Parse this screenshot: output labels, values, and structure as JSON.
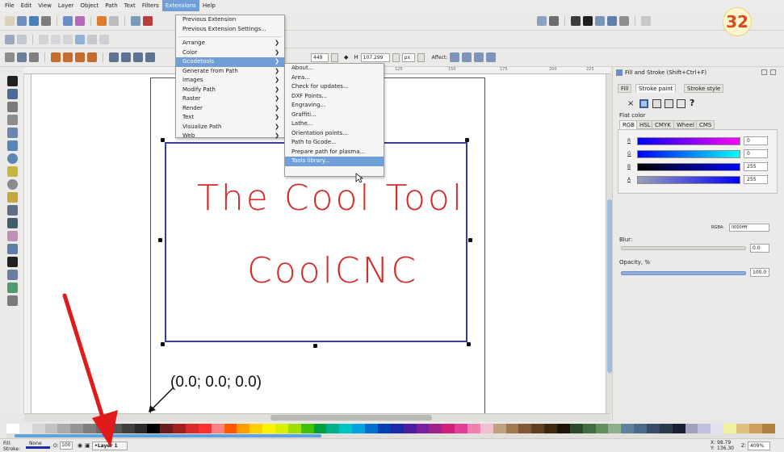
{
  "menubar": [
    "File",
    "Edit",
    "View",
    "Layer",
    "Object",
    "Path",
    "Text",
    "Filters",
    "Extensions",
    "Help"
  ],
  "active_menu": "Extensions",
  "extensions_menu": {
    "top": [
      "Previous Extension",
      "Previous Extension Settings..."
    ],
    "items": [
      "Arrange",
      "Color",
      "Gcodetools",
      "Generate from Path",
      "Images",
      "Modify Path",
      "Raster",
      "Render",
      "Text",
      "Visualize Path",
      "Web"
    ],
    "highlighted": "Gcodetools"
  },
  "gcodetools_menu": {
    "items": [
      "About...",
      "Area...",
      "Check for updates...",
      "DXF Points...",
      "Engraving...",
      "Graffiti...",
      "Lathe...",
      "Orientation points...",
      "Path to Gcode...",
      "Prepare path for plasma...",
      "Tools library..."
    ],
    "highlighted": "Tools library..."
  },
  "toolbar_fields": {
    "h_label": "H",
    "h_value": "107.299",
    "w_value": "449",
    "unit": "px",
    "affect_label": "Affect:"
  },
  "ruler_labels": [
    "125",
    "150",
    "175",
    "200",
    "225"
  ],
  "canvas": {
    "line1": "The Cool Tool",
    "line2": "CoolCNC",
    "origin_label": "(0.0; 0.0; 0.0)"
  },
  "badge": "32",
  "fill_stroke": {
    "title": "Fill and Stroke (Shift+Ctrl+F)",
    "tabs": [
      "Fill",
      "Stroke paint",
      "Stroke style"
    ],
    "flat_color": "Flat color",
    "modes": [
      "RGB",
      "HSL",
      "CMYK",
      "Wheel",
      "CMS"
    ],
    "channels": [
      {
        "label": "R",
        "value": "0"
      },
      {
        "label": "G",
        "value": "0"
      },
      {
        "label": "B",
        "value": "255"
      },
      {
        "label": "A",
        "value": "255"
      }
    ],
    "rgba_label": "RGBA:",
    "rgba_value": "0000ffff",
    "blur_label": "Blur:",
    "blur_value": "0.0",
    "opacity_label": "Opacity, %",
    "opacity_value": "100.0",
    "unknown_icon": "?"
  },
  "statusbar": {
    "fill_label": "Fill:",
    "stroke_label": "Stroke:",
    "fill_value": "None",
    "o_label": "O:",
    "o_value": "100",
    "layer": "•Layer 1",
    "x_label": "X:",
    "x_value": "98.79",
    "y_label": "Y:",
    "y_value": "136.30",
    "z_label": "Z:",
    "zoom": "409%"
  },
  "colors": {
    "text_red": "#d52a2a",
    "selection_blue": "#3a3d98",
    "menu_highlight": "#6f9fd6",
    "arrow_red": "#e11b1b"
  }
}
